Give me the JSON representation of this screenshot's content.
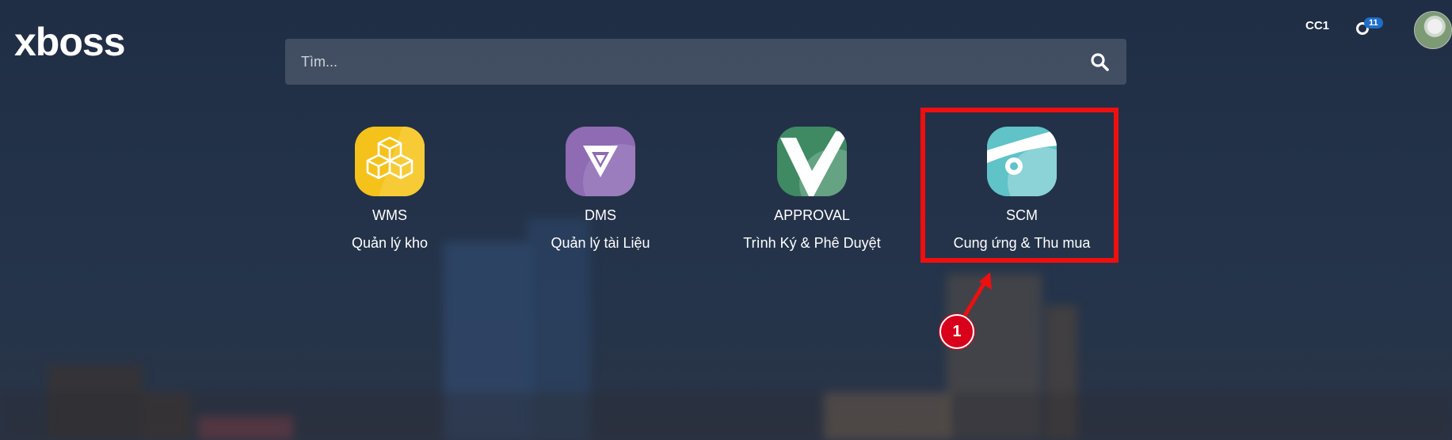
{
  "header": {
    "logo_text": "xboss",
    "company": "CC1",
    "activity_badge": "11"
  },
  "search": {
    "placeholder": "Tìm..."
  },
  "apps": [
    {
      "name": "WMS",
      "desc": "Quản lý kho",
      "color": "#f5c21b"
    },
    {
      "name": "DMS",
      "desc": "Quản lý tài Liệu",
      "color": "#8e6bb3"
    },
    {
      "name": "APPROVAL",
      "desc": "Trình Ký & Phê Duyệt",
      "color": "#3f8a63"
    },
    {
      "name": "SCM",
      "desc": "Cung ứng & Thu mua",
      "color": "#5fc3c8"
    }
  ],
  "annotation": {
    "step": "1",
    "color": "#ee0f0f"
  }
}
